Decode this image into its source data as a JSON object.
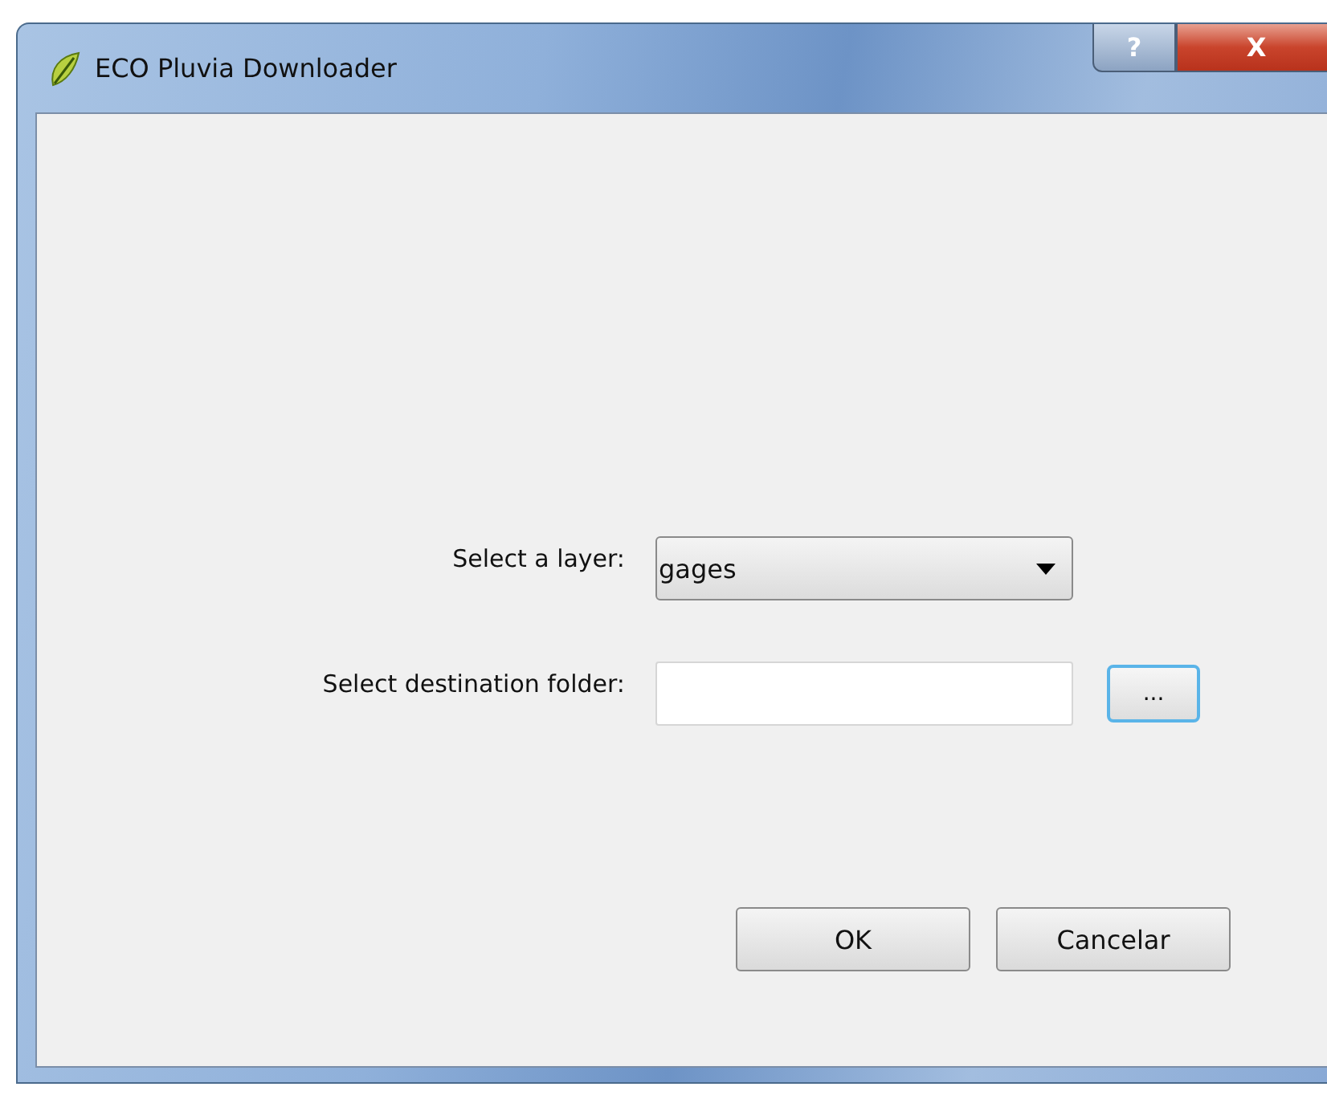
{
  "window": {
    "title": "ECO Pluvia Downloader",
    "help_button": "?",
    "close_button": "X"
  },
  "form": {
    "layer_label": "Select a layer:",
    "layer_value": "gages",
    "folder_label": "Select destination folder:",
    "browse_button": {
      "label": "...",
      "focused": true
    }
  },
  "buttons": [
    "OK",
    "Cancelar"
  ]
}
